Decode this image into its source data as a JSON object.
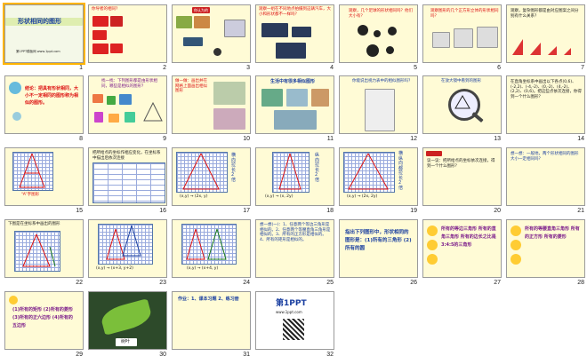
{
  "slides": [
    {
      "n": "1",
      "title": "形状相同的图形",
      "caption": "第1PPT模板网 www.1ppt.com"
    },
    {
      "n": "2",
      "text": "你导者的相同?"
    },
    {
      "n": "3",
      "text": "你认为的"
    },
    {
      "n": "4",
      "text": "观察一组在不同地点拍摄到这辆汽车，大小和形状都不一样吗？"
    },
    {
      "n": "5",
      "text": "观察，几个足球的形状相同吗？他们大小有？"
    },
    {
      "n": "6",
      "text": "观察图形的几个正方形立体的形状相同吗？"
    },
    {
      "n": "7",
      "text": "观察，复杂图形都是由对应图案之间分别有什么关系？"
    },
    {
      "n": "8",
      "text": "结论：把具有形状相同，大小不一定相同的图形称为相似的图形。"
    },
    {
      "n": "9",
      "text": "找一找：下列图形都是由形状相同，哪些是相似的图形？"
    },
    {
      "n": "10",
      "text": "做一做：画出并在网格上面画出相似图形"
    },
    {
      "n": "11",
      "text": "生活中有很多相似图形"
    },
    {
      "n": "12",
      "text": "你能说出视力表中的相似图形吗？"
    },
    {
      "n": "13",
      "text": "在放大镜中看到的图形"
    },
    {
      "n": "14",
      "text": "在直角坐标系中画出以下各点(0,6)、(-2,2)、(-4,-2)、(0,-2)、(4,-2)、(2,2)、(0,6)。把这些点依次连接，你得到一个什么图形？"
    },
    {
      "n": "15",
      "text": "“A”字图形"
    },
    {
      "n": "16",
      "text": "把所给点的坐标作相应变化，在坐标系中描出后依次连接"
    },
    {
      "n": "17",
      "text": "(x,y) → (2x, y)",
      "side": "横向拉长2倍"
    },
    {
      "n": "18",
      "text": "(x,y) → (x, 2y)",
      "side": "纵向拉长2倍"
    },
    {
      "n": "19",
      "text": "(x,y) → (2x, 2y)",
      "side": "横纵向都拉长2倍"
    },
    {
      "n": "20",
      "text": "议一议：把所给点的坐标依次连接，得到一个什么图形？"
    },
    {
      "n": "21",
      "text": "想一想：一般地，两个形状相同的图形大小一定相同吗？"
    },
    {
      "n": "22",
      "text": "下图是在坐标系中画出的图形"
    },
    {
      "n": "23",
      "text": "(x,y) → (x+3, y+2)"
    },
    {
      "n": "24",
      "text": "(x,y) → (x+4, y)"
    },
    {
      "n": "25",
      "text": "想一想(一)：1、任意两个等边三角形是相似的。2、任意两个等腰直角三角形是相似的。3、所有的正方形是相似的。4、所有的矩形是相似的。"
    },
    {
      "n": "26",
      "text": "指出下列图形中，形状相同的图形是：(1)所有的三角形 (2)所有的圆"
    },
    {
      "n": "27",
      "text": "所有的等边三角形 所有的直角三角形 所有的边长之比是3:4:5的三角形"
    },
    {
      "n": "28",
      "text": "所有的等腰直角三角形 所有的正方形 所有的菱形"
    },
    {
      "n": "29",
      "text": "(1)所有的矩形 (2)所有的菱形 (3)所有的正六边形 (4)所有的五边形"
    },
    {
      "n": "30",
      "text": "树叶"
    },
    {
      "n": "31",
      "text": "作业：1、课本习题 2、练习册"
    },
    {
      "n": "32",
      "text": "第1PPT",
      "sub": "www.1ppt.com"
    }
  ],
  "colors": {
    "slide_bg": "#fffbd6",
    "selected": "#ffb400",
    "title_blue": "#1a3fa0",
    "accent_red": "#d11"
  }
}
